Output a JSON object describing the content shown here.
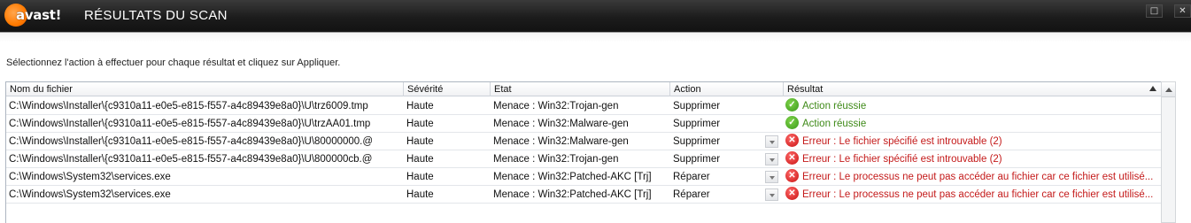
{
  "window": {
    "logo_text": "avast!",
    "title": "RÉSULTATS DU SCAN",
    "maximize_glyph": "□",
    "close_glyph": "✕"
  },
  "instruction": "Sélectionnez l'action à effectuer pour chaque résultat et cliquez sur Appliquer.",
  "table": {
    "columns": [
      "Nom du fichier",
      "Sévérité",
      "Etat",
      "Action",
      "Résultat"
    ],
    "rows": [
      {
        "file": "C:\\Windows\\Installer\\{c9310a11-e0e5-e815-f557-a4c89439e8a0}\\U\\trz6009.tmp",
        "severity": "Haute",
        "state": "Menace : Win32:Trojan-gen",
        "action": "Supprimer",
        "result": "Action réussie",
        "status": "ok",
        "dropdown": false
      },
      {
        "file": "C:\\Windows\\Installer\\{c9310a11-e0e5-e815-f557-a4c89439e8a0}\\U\\trzAA01.tmp",
        "severity": "Haute",
        "state": "Menace : Win32:Malware-gen",
        "action": "Supprimer",
        "result": "Action réussie",
        "status": "ok",
        "dropdown": false
      },
      {
        "file": "C:\\Windows\\Installer\\{c9310a11-e0e5-e815-f557-a4c89439e8a0}\\U\\80000000.@",
        "severity": "Haute",
        "state": "Menace : Win32:Malware-gen",
        "action": "Supprimer",
        "result": "Erreur : Le fichier spécifié est introuvable (2)",
        "status": "error",
        "dropdown": true
      },
      {
        "file": "C:\\Windows\\Installer\\{c9310a11-e0e5-e815-f557-a4c89439e8a0}\\U\\800000cb.@",
        "severity": "Haute",
        "state": "Menace : Win32:Trojan-gen",
        "action": "Supprimer",
        "result": "Erreur : Le fichier spécifié est introuvable (2)",
        "status": "error",
        "dropdown": true
      },
      {
        "file": "C:\\Windows\\System32\\services.exe",
        "severity": "Haute",
        "state": "Menace : Win32:Patched-AKC [Trj]",
        "action": "Réparer",
        "result": "Erreur : Le processus ne peut pas accéder au fichier car ce fichier est utilisé...",
        "status": "error",
        "dropdown": true
      },
      {
        "file": "C:\\Windows\\System32\\services.exe",
        "severity": "Haute",
        "state": "Menace : Win32:Patched-AKC [Trj]",
        "action": "Réparer",
        "result": "Erreur : Le processus ne peut pas accéder au fichier car ce fichier est utilisé...",
        "status": "error",
        "dropdown": true
      }
    ]
  },
  "icons": {
    "ok": "check-circle-icon",
    "error": "error-circle-icon"
  },
  "colors": {
    "success_text": "#3f8a18",
    "error_text": "#c41a1a",
    "brand_orange": "#ff7a00"
  }
}
